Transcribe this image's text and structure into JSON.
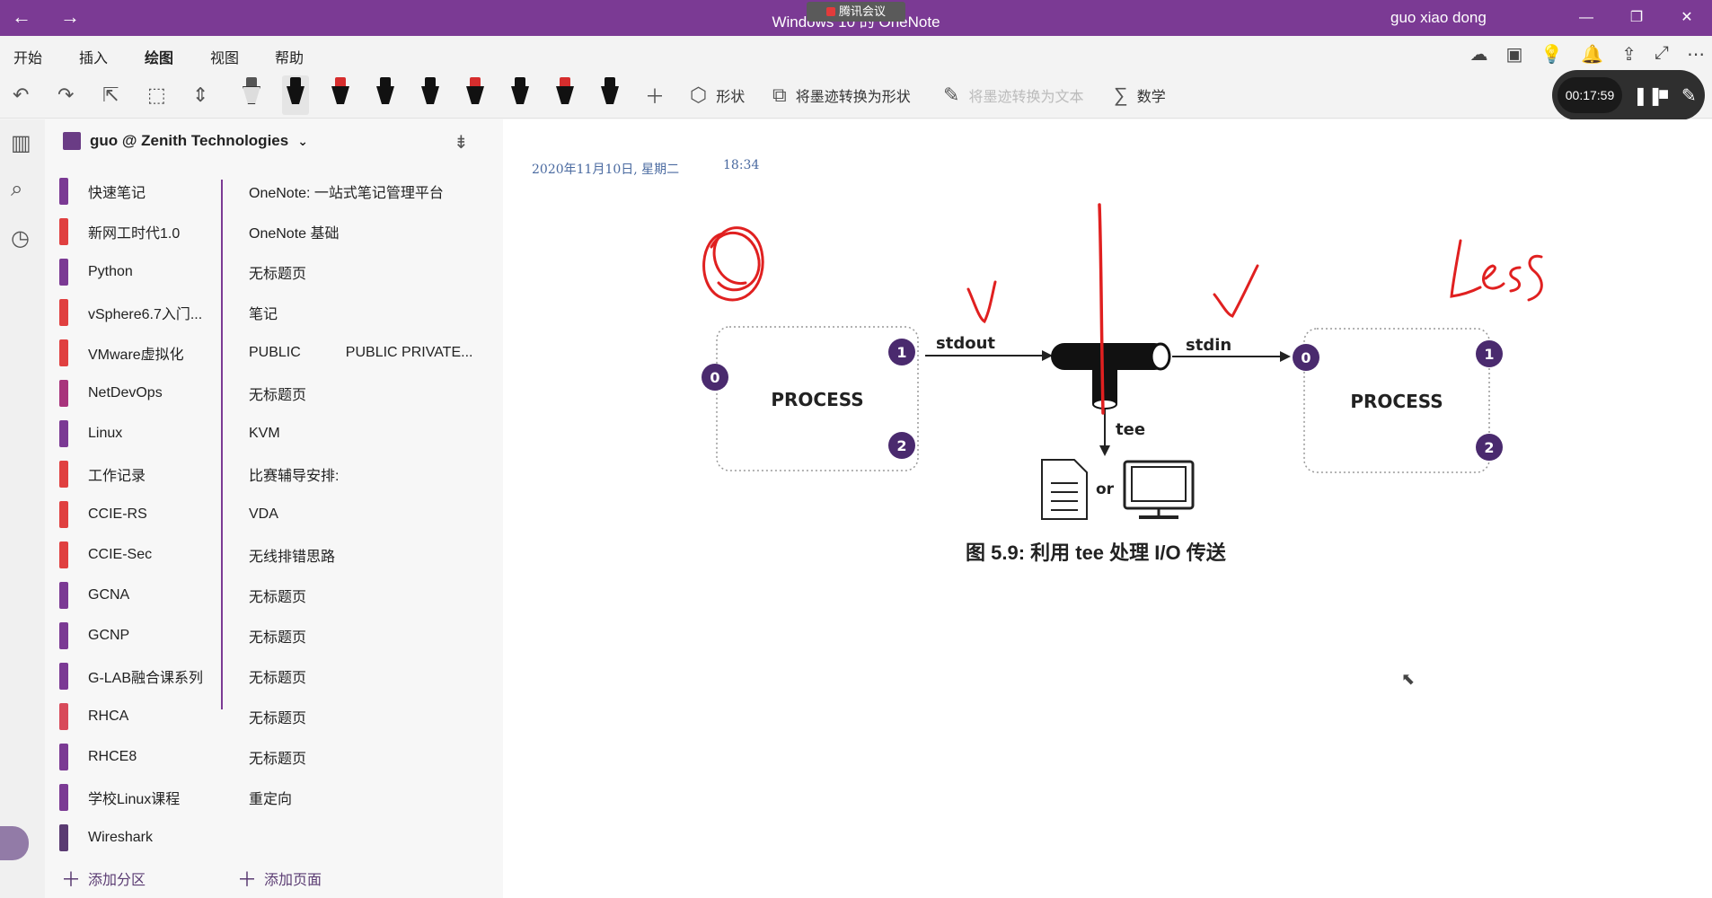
{
  "titlebar": {
    "title": "Windows 10 的 OneNote",
    "meeting": "腾讯会议",
    "user": "guo xiao dong",
    "back": "←",
    "forward": "→"
  },
  "ribbon": {
    "tabs": [
      "开始",
      "插入",
      "绘图",
      "视图",
      "帮助"
    ],
    "active_tab": "绘图"
  },
  "toolbar": {
    "shapes_label": "形状",
    "ink_to_shape_label": "将墨迹转换为形状",
    "ink_to_text_label": "将墨迹转换为文本",
    "math_label": "数学",
    "pen_colors": [
      "#111111",
      "#d62d2d",
      "#111111",
      "#111111",
      "#d62d2d",
      "#111111",
      "#d62d2d",
      "#111111",
      "#111111"
    ]
  },
  "recording": {
    "time": "00:17:59"
  },
  "notebook": {
    "name": "guo @ Zenith Technologies"
  },
  "sections": [
    {
      "label": "快速笔记",
      "color": "#7b3a94"
    },
    {
      "label": "新网工时代1.0",
      "color": "#e04040"
    },
    {
      "label": "Python",
      "color": "#7b3a94"
    },
    {
      "label": "vSphere6.7入门...",
      "color": "#e04040"
    },
    {
      "label": "VMware虚拟化",
      "color": "#e04040"
    },
    {
      "label": "NetDevOps",
      "color": "#a8347c"
    },
    {
      "label": "Linux",
      "color": "#7b3a94"
    },
    {
      "label": "工作记录",
      "color": "#e04040"
    },
    {
      "label": "CCIE-RS",
      "color": "#e04040"
    },
    {
      "label": "CCIE-Sec",
      "color": "#e04040"
    },
    {
      "label": "GCNA",
      "color": "#7b3a94"
    },
    {
      "label": "GCNP",
      "color": "#7b3a94"
    },
    {
      "label": "G-LAB融合课系列",
      "color": "#7b3a94"
    },
    {
      "label": "RHCA",
      "color": "#d84a5a"
    },
    {
      "label": "RHCE8",
      "color": "#7b3a94"
    },
    {
      "label": "学校Linux课程",
      "color": "#7b3a94"
    },
    {
      "label": "Wireshark",
      "color": "#5a3b72"
    }
  ],
  "pages": [
    {
      "label": "OneNote: 一站式笔记管理平台",
      "second": ""
    },
    {
      "label": "OneNote 基础",
      "second": ""
    },
    {
      "label": "无标题页",
      "second": ""
    },
    {
      "label": "笔记",
      "second": ""
    },
    {
      "label": "PUBLIC",
      "second": "PUBLIC PRIVATE..."
    },
    {
      "label": "无标题页",
      "second": ""
    },
    {
      "label": "KVM",
      "second": ""
    },
    {
      "label": "比赛辅导安排:",
      "second": ""
    },
    {
      "label": "VDA",
      "second": ""
    },
    {
      "label": "无线排错思路",
      "second": ""
    },
    {
      "label": "无标题页",
      "second": ""
    },
    {
      "label": "无标题页",
      "second": ""
    },
    {
      "label": "无标题页",
      "second": ""
    },
    {
      "label": "无标题页",
      "second": ""
    },
    {
      "label": "无标题页",
      "second": ""
    },
    {
      "label": "重定向",
      "second": ""
    }
  ],
  "footer": {
    "add_section": "添加分区",
    "add_page": "添加页面"
  },
  "page_content": {
    "date": "2020年11月10日, 星期二",
    "time": "18:34",
    "diagram": {
      "left_process": "PROCESS",
      "right_process": "PROCESS",
      "stdout": "stdout",
      "stdin": "stdin",
      "tee": "tee",
      "or": "or",
      "fd0": "0",
      "fd1": "1",
      "fd2": "2",
      "annotation": "Less"
    },
    "caption": "图 5.9: 利用 tee 处理 I/O 传送"
  }
}
